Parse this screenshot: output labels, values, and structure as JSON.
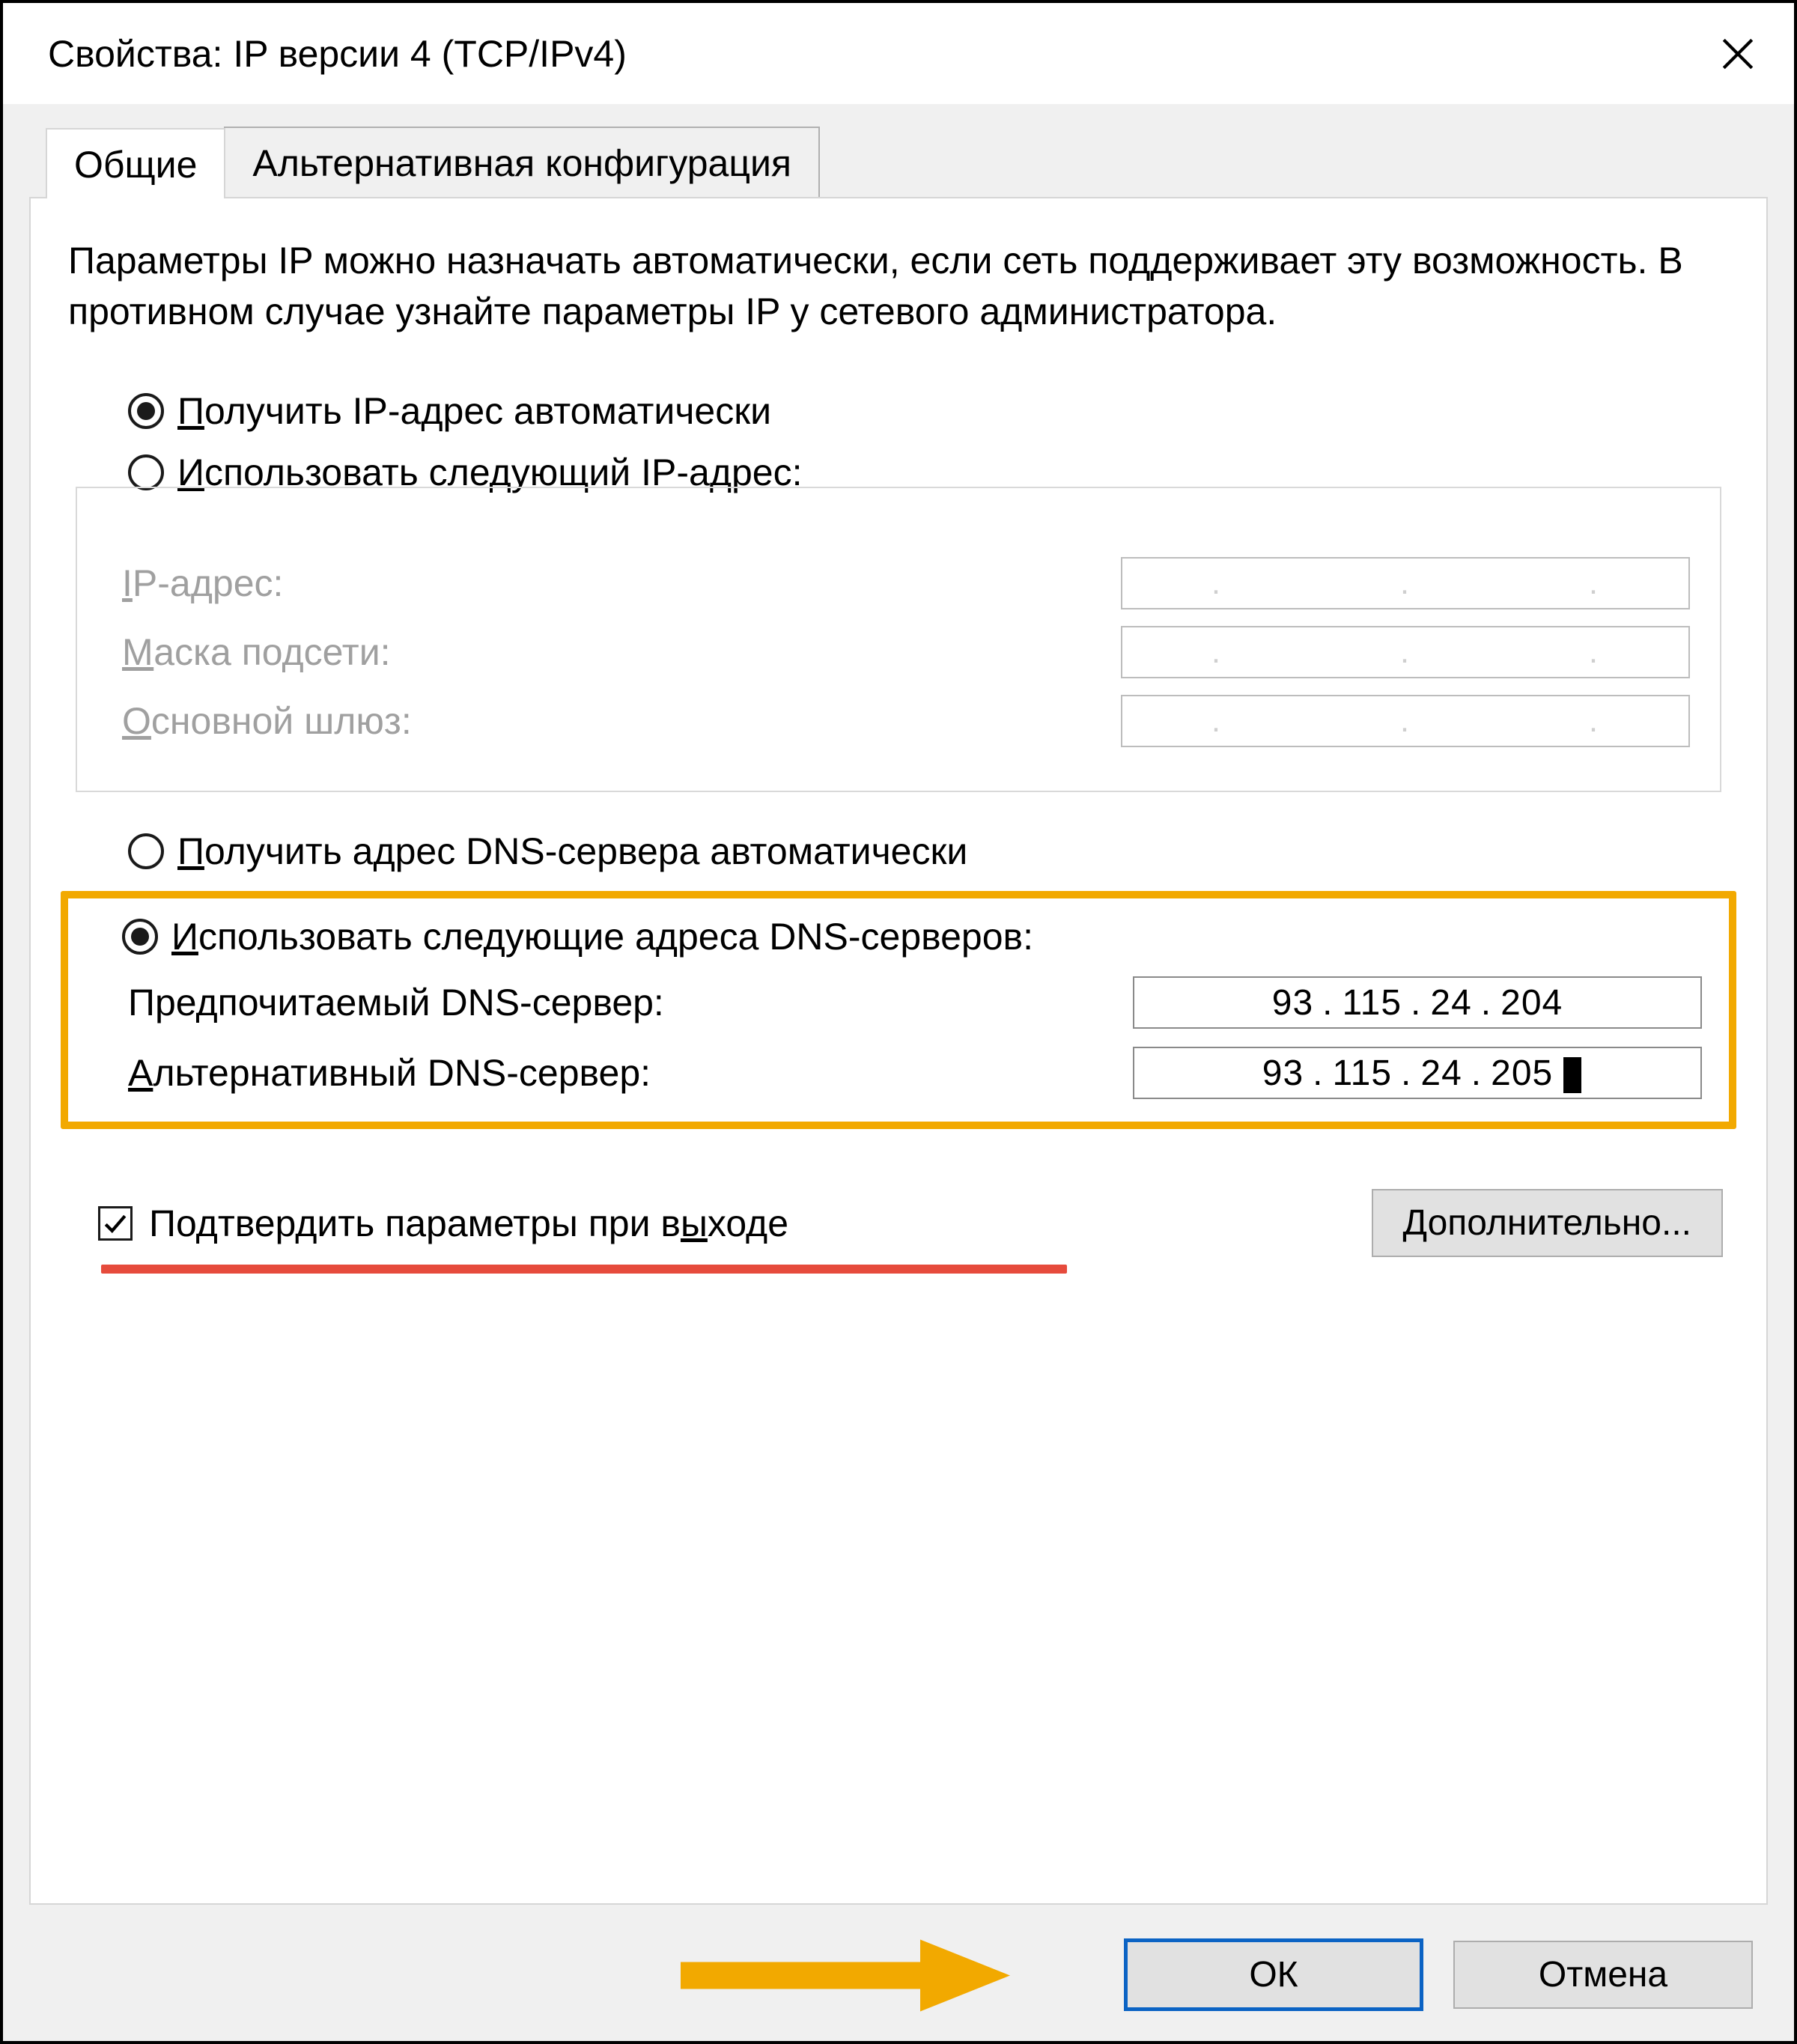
{
  "window": {
    "title": "Свойства: IP версии 4 (TCP/IPv4)"
  },
  "tabs": {
    "general": "Общие",
    "alternate": "Альтернативная конфигурация"
  },
  "intro_text": "Параметры IP можно назначать автоматически, если сеть поддерживает эту возможность. В противном случае узнайте параметры IP у сетевого администратора.",
  "ip_section": {
    "radio_auto_pre": "П",
    "radio_auto_rest": "олучить IP-адрес автоматически",
    "radio_manual_pre": "И",
    "radio_manual_rest": "спользовать следующий IP-адрес:",
    "label_ip_pre": "I",
    "label_ip_rest": "P-адрес:",
    "label_mask_pre": "М",
    "label_mask_rest": "аска подсети:",
    "label_gateway_pre": "О",
    "label_gateway_rest": "сновной шлюз:"
  },
  "dns_section": {
    "radio_auto_pre": "П",
    "radio_auto_rest": "олучить адрес DNS-сервера автоматически",
    "radio_manual_pre": "И",
    "radio_manual_rest": "спользовать следующие адреса DNS-серверов:",
    "label_pref": "Предпочитаемый DNS-сервер:",
    "label_alt_pre": "А",
    "label_alt_rest": "льтернативный DNS-сервер:",
    "preferred_dns": {
      "o1": "93",
      "o2": "115",
      "o3": "24",
      "o4": "204"
    },
    "alternate_dns": {
      "o1": "93",
      "o2": "115",
      "o3": "24",
      "o4": "205"
    }
  },
  "validate_checkbox_pre": "Подтвердить параметры при в",
  "validate_checkbox_ul": "ы",
  "validate_checkbox_post": "ходе",
  "advanced_button_pre": "Д",
  "advanced_button_rest": "ополнительно...",
  "buttons": {
    "ok": "ОК",
    "cancel": "Отмена"
  }
}
